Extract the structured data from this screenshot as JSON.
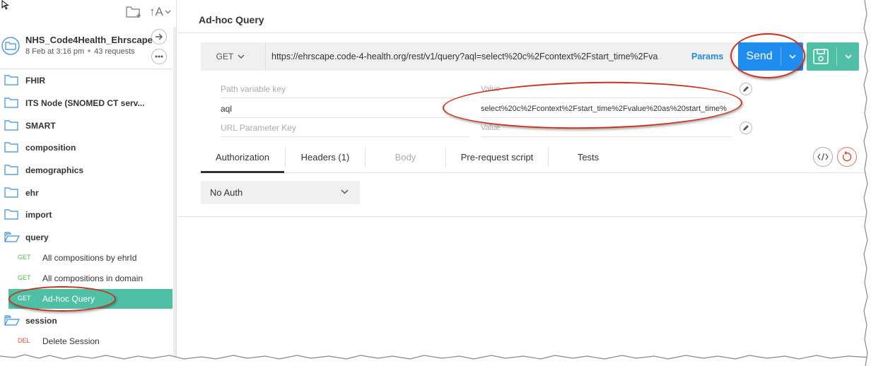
{
  "sidebar": {
    "collection": {
      "name": "NHS_Code4Health_Ehrscape",
      "date": "8 Feb at 3:16 pm",
      "requests": "43 requests"
    },
    "sort_label": "↑A",
    "folders": [
      {
        "name": "FHIR",
        "open": false
      },
      {
        "name": "ITS Node (SNOMED CT serv...",
        "open": false
      },
      {
        "name": "SMART",
        "open": false
      },
      {
        "name": "composition",
        "open": false
      },
      {
        "name": "demographics",
        "open": false
      },
      {
        "name": "ehr",
        "open": false
      },
      {
        "name": "import",
        "open": false
      },
      {
        "name": "query",
        "open": true
      }
    ],
    "query_requests": [
      {
        "method": "GET",
        "name": "All compositions by ehrId"
      },
      {
        "method": "GET",
        "name": "All compositions in domain"
      },
      {
        "method": "GET",
        "name": "Ad-hoc Query",
        "active": true
      }
    ],
    "session_folder": {
      "name": "session",
      "open": true
    },
    "session_requests": [
      {
        "method": "DEL",
        "name": "Delete Session"
      }
    ]
  },
  "main": {
    "title": "Ad-hoc Query",
    "method": "GET",
    "url": "https://ehrscape.code-4-health.org/rest/v1/query?aql=select%20c%2Fcontext%2Fstart_time%2Fva",
    "params_label": "Params",
    "send_label": "Send",
    "params": [
      {
        "key_placeholder": "Path variable key",
        "value_placeholder": "Value"
      },
      {
        "key": "aql",
        "value": "select%20c%2Fcontext%2Fstart_time%2Fvalue%20as%20start_time%"
      },
      {
        "key_placeholder": "URL Parameter Key",
        "value_placeholder": "Value"
      }
    ],
    "tabs": [
      {
        "label": "Authorization",
        "active": true
      },
      {
        "label": "Headers (1)"
      },
      {
        "label": "Body",
        "disabled": true
      },
      {
        "label": "Pre-request script"
      },
      {
        "label": "Tests"
      }
    ],
    "auth_type": "No Auth"
  },
  "colors": {
    "send": "#1f8cef",
    "accent": "#4fbfa5",
    "get": "#54b848",
    "del": "#e04f3b",
    "annotation": "#c9331f"
  }
}
